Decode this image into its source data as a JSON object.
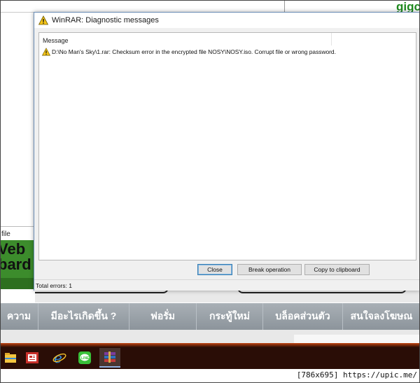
{
  "background": {
    "corner_text": "gigc",
    "file_label": "file",
    "logo_text": [
      "Veb",
      "bard"
    ],
    "navbar": {
      "items": [
        "ความ",
        "มีอะไรเกิดขึ้น ?",
        "ฟอรั่ม",
        "กระทู้ใหม่",
        "บล็อคส่วนตัว",
        "สนใจลงโฆษณ"
      ]
    }
  },
  "dialog": {
    "title": "WinRAR: Diagnostic messages",
    "title_icon": "warning-icon",
    "column_header": "Message",
    "messages": [
      {
        "icon": "warning-icon",
        "text": "D:\\No Man's Sky\\1.rar: Checksum error in the encrypted file NOSY\\NOSY.iso. Corrupt file or wrong password."
      }
    ],
    "buttons": {
      "close": "Close",
      "break": "Break operation",
      "copy": "Copy to clipboard"
    },
    "status": "Total errors: 1"
  },
  "taskbar": {
    "icons": [
      "file-explorer-icon",
      "news-app-icon",
      "internet-explorer-icon",
      "line-app-icon",
      "winrar-icon"
    ]
  },
  "footer": {
    "watermark": "[786x695] https://upic.me/"
  },
  "colors": {
    "navbar": "#9aa1a7",
    "taskbar": "#2a0d06",
    "logo_green": "#3c8c2c",
    "dialog_border": "#6b8db5"
  }
}
